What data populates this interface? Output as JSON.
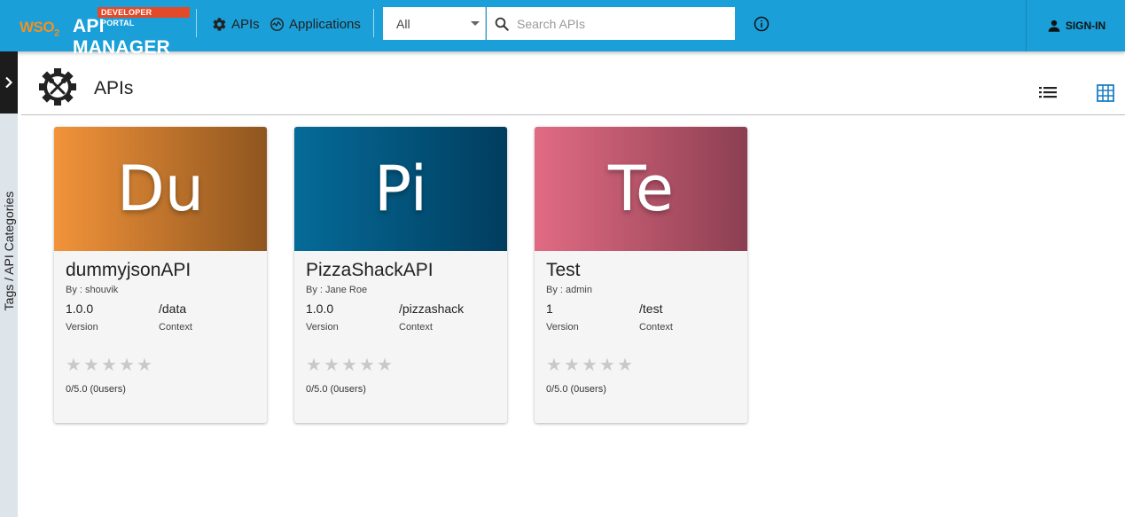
{
  "header": {
    "badge": "DEVELOPER PORTAL",
    "brand_prefix": "WSO",
    "brand_sub": "2",
    "brand_name": "API MANAGER",
    "nav": [
      {
        "label": "APIs",
        "icon": "gear-icon"
      },
      {
        "label": "Applications",
        "icon": "applications-icon"
      }
    ],
    "filter_selected": "All",
    "search_placeholder": "Search APIs",
    "sign_in_label": "SIGN-IN",
    "colors": {
      "bar": "#1a9fd9",
      "badge": "#e24a2a",
      "brand_accent": "#f39021"
    }
  },
  "sidebar": {
    "label": "Tags / API Categories"
  },
  "page": {
    "title": "APIs",
    "view_modes": [
      "list-view-icon",
      "grid-view-icon"
    ],
    "active_view": "grid"
  },
  "apis": [
    {
      "initials": "Du",
      "name": "dummyjsonAPI",
      "by": "By : shouvik",
      "version": "1.0.0",
      "version_label": "Version",
      "context": "/data",
      "context_label": "Context",
      "rating": "0/5.0 (0users)",
      "stars_filled": 0,
      "gradient": [
        "#f2933a",
        "#8f561f"
      ]
    },
    {
      "initials": "Pi",
      "name": "PizzaShackAPI",
      "by": "By : Jane Roe",
      "version": "1.0.0",
      "version_label": "Version",
      "context": "/pizzashack",
      "context_label": "Context",
      "rating": "0/5.0 (0users)",
      "stars_filled": 0,
      "gradient": [
        "#056b99",
        "#013d5e"
      ]
    },
    {
      "initials": "Te",
      "name": "Test",
      "by": "By : admin",
      "version": "1",
      "version_label": "Version",
      "context": "/test",
      "context_label": "Context",
      "rating": "0/5.0 (0users)",
      "stars_filled": 0,
      "gradient": [
        "#e16b83",
        "#8c3f52"
      ]
    }
  ]
}
